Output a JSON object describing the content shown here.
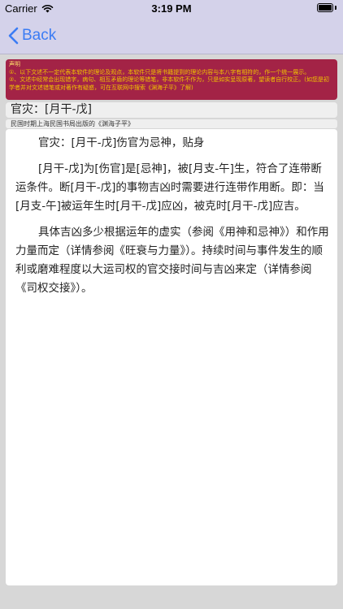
{
  "status_bar": {
    "carrier": "Carrier",
    "time": "3:19 PM"
  },
  "nav": {
    "back_label": "Back"
  },
  "disclaimer": {
    "title": "声明",
    "line1": "①、以下文述不一定代表本软件的理论及观点，本软件只是将书籍提到的理论内容与本八字有相符的，作一个统一展示。",
    "line2": "②、文述中经常会出现错字，病句、相互矛盾的理论等错笔，非本软件不作为，只是如实呈现原著，望读者自行校正。(如您是初学者并对文述错笔或对著作有疑惑，可在互联网中搜索《渊海子平》了解)"
  },
  "title": "官灾：[月干-戊]",
  "source": "民国时期上海民国书局出版的《渊海子平》",
  "content": {
    "p1": "官灾：[月干-戊]伤官为忌神，贴身",
    "p2": "[月干-戊]为[伤官]是[忌神]，被[月支-午]生，符合了连带断运条件。断[月干-戊]的事物吉凶时需要进行连带作用断。即：当[月支-午]被运年生时[月干-戊]应凶，被克时[月干-戊]应吉。",
    "p3": "具体吉凶多少根据运年的虚实（参阅《用神和忌神》）和作用力量而定（详情参阅《旺衰与力量》）。持续时间与事件发生的顺利或磨难程度以大运司权的官交接时间与吉凶来定（详情参阅《司权交接》）。"
  },
  "colors": {
    "nav_background": "#d4d2ea",
    "back_tint": "#3b7cf4",
    "disclaimer_background": "#a32346",
    "disclaimer_text": "#f0c400",
    "page_background": "#d7d7d7"
  }
}
